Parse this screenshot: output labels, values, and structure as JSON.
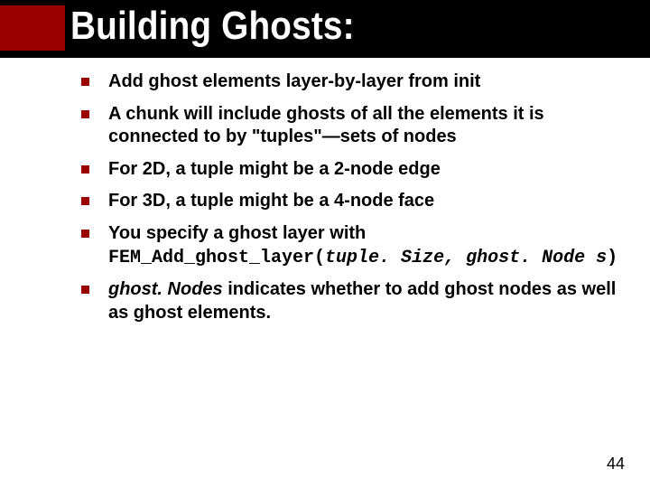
{
  "title": "Building Ghosts:",
  "bullets": [
    {
      "text": "Add ghost elements layer-by-layer from init"
    },
    {
      "text": "A chunk will include ghosts of all the elements it is connected to by \"tuples\"—sets of nodes"
    },
    {
      "text": "For 2D, a tuple might be a 2-node edge"
    },
    {
      "text": "For 3D, a tuple might be a 4-node face"
    },
    {
      "prefix": "You specify a ghost layer with ",
      "fn_name": "FEM_Add_ghost_layer(",
      "fn_args": "tuple. Size, ghost. Node s",
      "fn_close": ")"
    },
    {
      "ital": "ghost. Nodes",
      "rest": " indicates whether to add ghost nodes as well as ghost elements."
    }
  ],
  "page_number": "44"
}
